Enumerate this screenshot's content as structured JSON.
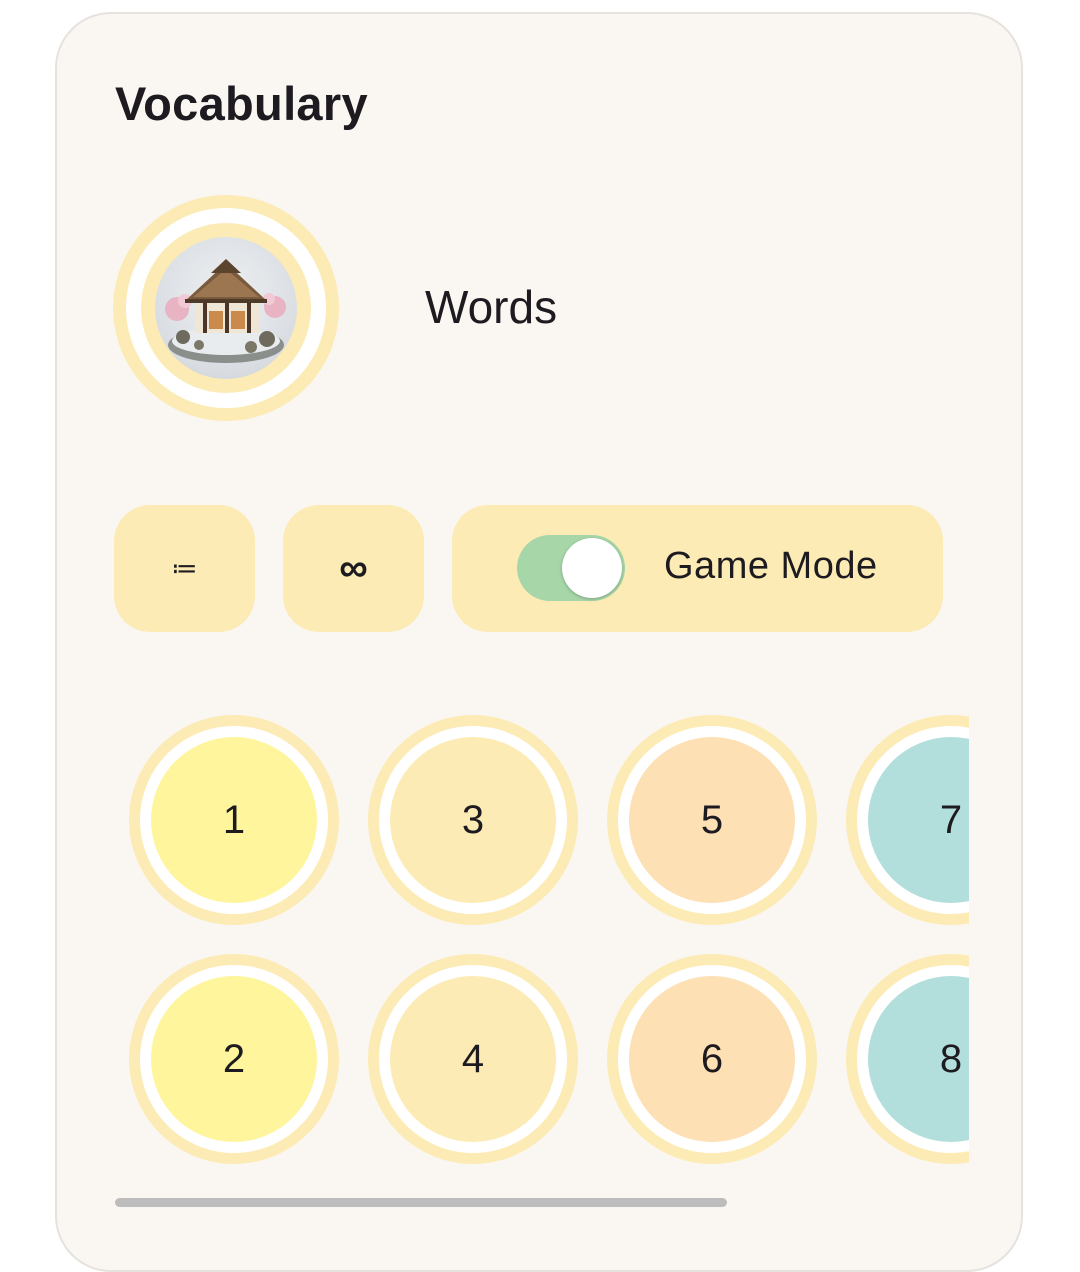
{
  "title": "Vocabulary",
  "deck": {
    "label": "Words",
    "image_icon": "thatched-farmhouse-image"
  },
  "chips": {
    "list_icon": "≔",
    "infinity_icon": "∞",
    "game_mode_label": "Game Mode",
    "game_mode_on": true
  },
  "levels": [
    {
      "label": "1",
      "color": "#fef59c"
    },
    {
      "label": "2",
      "color": "#fef59c"
    },
    {
      "label": "3",
      "color": "#fdebb5"
    },
    {
      "label": "4",
      "color": "#fdebb5"
    },
    {
      "label": "5",
      "color": "#fde0b4"
    },
    {
      "label": "6",
      "color": "#fde0b4"
    },
    {
      "label": "7",
      "color": "#b2dfdb"
    },
    {
      "label": "8",
      "color": "#b2dfdb"
    }
  ],
  "colors": {
    "accent_gold": "#fdebb5",
    "toggle_track": "#a7d6a8",
    "card_background": "#faf7f3"
  }
}
